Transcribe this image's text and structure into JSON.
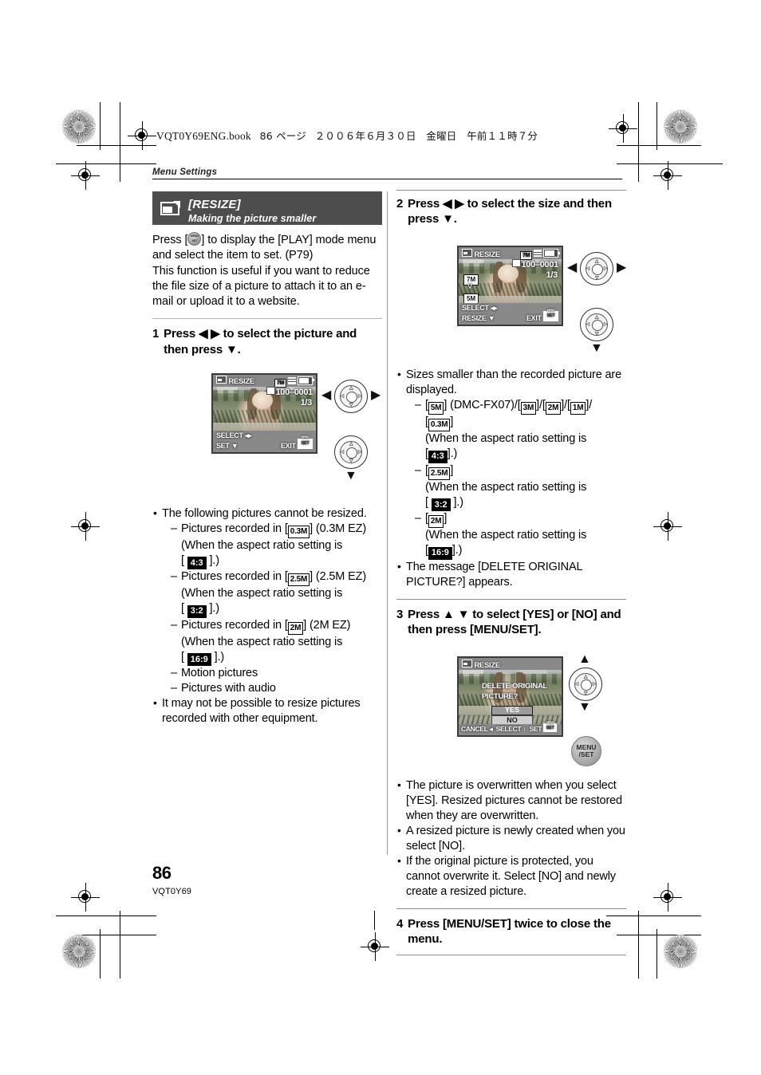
{
  "document": {
    "book_header": "VQT0Y69ENG.book",
    "book_page_label": "86 ページ",
    "book_date": "２００６年６月３０日　金曜日　午前１１時７分",
    "running_head": "Menu Settings",
    "page_number": "86",
    "page_code": "VQT0Y69"
  },
  "section": {
    "icon": "resize-icon",
    "title": "[RESIZE]",
    "subtitle": "Making the picture smaller",
    "intro_1_a": "Press [",
    "intro_1_b": "] to display the [PLAY] mode menu and select the item to set. (P79)",
    "intro_2": "This function is useful if you want to reduce the file size of a picture to attach it to an e-mail or upload it to a website."
  },
  "steps": {
    "s1": {
      "num": "1",
      "text": "Press ◀ ▶ to select the picture and then press ▼."
    },
    "s2": {
      "num": "2",
      "text": "Press ◀ ▶ to select the size and then press ▼."
    },
    "s3": {
      "num": "3",
      "text": "Press ▲ ▼ to select [YES] or [NO] and then press [MENU/SET]."
    },
    "s4": {
      "num": "4",
      "text": "Press [MENU/SET] twice to close the menu."
    }
  },
  "lcd1": {
    "title": "RESIZE",
    "size_badge": "7M",
    "quality_icon": "quality-fine-icon",
    "battery_icon": "battery-icon",
    "folder_file": "100–0001",
    "counter": "1/3",
    "hint_select": "SELECT",
    "hint_set": "SET",
    "hint_exit": "EXIT"
  },
  "lcd2": {
    "title": "RESIZE",
    "size_badge": "7M",
    "quality_icon": "quality-standard-icon",
    "battery_icon": "battery-icon",
    "folder_file": "100–0001",
    "counter": "1/3",
    "option_top": "7M",
    "option_bottom": "5M",
    "hint_select": "SELECT",
    "hint_resize": "RESIZE",
    "hint_exit": "EXIT"
  },
  "lcd3": {
    "title": "RESIZE",
    "message_line1": "DELETE ORIGINAL",
    "message_line2": "PICTURE?",
    "option_yes": "YES",
    "option_no": "NO",
    "hint_cancel": "CANCEL",
    "hint_select": "SELECT",
    "hint_set": "SET"
  },
  "notes_step1": {
    "b1": "The following pictures cannot be resized.",
    "d1_pre": "Pictures recorded in [",
    "d1_badge": "0.3M",
    "d1_post": "] (0.3M EZ)",
    "d1_cond": "(When the aspect ratio setting is",
    "d1_ratio": "4:3",
    "d2_pre": "Pictures recorded in [",
    "d2_badge": "2.5M",
    "d2_post": "] (2.5M EZ)",
    "d2_cond": "(When the aspect ratio setting is",
    "d2_ratio": "3:2",
    "d3_pre": "Pictures recorded in [",
    "d3_badge": "2M",
    "d3_post": "] (2M EZ)",
    "d3_cond": "(When the aspect ratio setting is",
    "d3_ratio": "16:9",
    "d4": "Motion pictures",
    "d5": "Pictures with audio",
    "b2": "It may not be possible to resize pictures recorded with other equipment."
  },
  "notes_step2": {
    "b1": "Sizes smaller than the recorded picture are displayed.",
    "d1_badges": [
      "5M",
      "3M",
      "2M",
      "1M",
      "0.3M"
    ],
    "d1_model": "(DMC-FX07)",
    "d1_cond": "(When the aspect ratio setting is",
    "d1_ratio": "4:3",
    "d2_badge": "2.5M",
    "d2_cond": "(When the aspect ratio setting is",
    "d2_ratio": "3:2",
    "d3_badge": "2M",
    "d3_cond": "(When the aspect ratio setting is",
    "d3_ratio": "16:9",
    "b2": "The message [DELETE ORIGINAL PICTURE?] appears."
  },
  "notes_step3": {
    "b1": "The picture is overwritten when you select [YES]. Resized pictures cannot be restored when they are overwritten.",
    "b2": "A resized picture is newly created when you select [NO].",
    "b3": "If the original picture is protected, you cannot overwrite it. Select [NO] and newly create a resized picture."
  },
  "colors": {
    "title_bar": "#4d4d4d",
    "lcd_bar": "#898989",
    "rule": "#8f8f8f"
  }
}
